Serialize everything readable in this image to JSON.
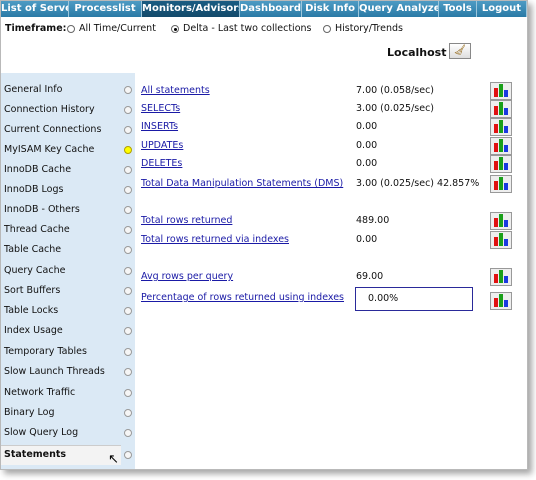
{
  "nav": {
    "tabs": [
      {
        "label": "List of Servers",
        "active": false
      },
      {
        "label": "Processlist",
        "active": false
      },
      {
        "label": "Monitors/Advisors",
        "active": true
      },
      {
        "label": "Dashboard",
        "active": false
      },
      {
        "label": "Disk Info",
        "active": false
      },
      {
        "label": "Query Analyzer",
        "active": false
      },
      {
        "label": "Tools",
        "active": false
      },
      {
        "label": "Logout",
        "active": false
      }
    ]
  },
  "timeframe": {
    "label": "Timeframe:",
    "options": [
      {
        "label": "All Time/Current",
        "selected": false
      },
      {
        "label": "Delta - Last two collections",
        "selected": true
      },
      {
        "label": "History/Trends",
        "selected": false
      }
    ]
  },
  "host": {
    "name": "Localhost",
    "button_icon": "broom-icon"
  },
  "sidebar": {
    "items": [
      {
        "label": "General Info",
        "status": "none"
      },
      {
        "label": "Connection History",
        "status": "none"
      },
      {
        "label": "Current Connections",
        "status": "none"
      },
      {
        "label": "MyISAM Key Cache",
        "status": "warning"
      },
      {
        "label": "InnoDB Cache",
        "status": "none"
      },
      {
        "label": "InnoDB Logs",
        "status": "none"
      },
      {
        "label": "InnoDB - Others",
        "status": "none"
      },
      {
        "label": "Thread Cache",
        "status": "none"
      },
      {
        "label": "Table Cache",
        "status": "none"
      },
      {
        "label": "Query Cache",
        "status": "none"
      },
      {
        "label": "Sort Buffers",
        "status": "none"
      },
      {
        "label": "Table Locks",
        "status": "none"
      },
      {
        "label": "Index Usage",
        "status": "none"
      },
      {
        "label": "Temporary Tables",
        "status": "none"
      },
      {
        "label": "Slow Launch Threads",
        "status": "none"
      },
      {
        "label": "Network Traffic",
        "status": "none"
      },
      {
        "label": "Binary Log",
        "status": "none"
      },
      {
        "label": "Slow Query Log",
        "status": "none"
      },
      {
        "label": "Statements",
        "status": "none",
        "selected": true
      }
    ]
  },
  "stats": [
    {
      "label": "All statements",
      "value": "7.00 (0.058/sec)"
    },
    {
      "label": "SELECTs",
      "value": "3.00 (0.025/sec)"
    },
    {
      "label": "INSERTs",
      "value": "0.00"
    },
    {
      "label": "UPDATEs",
      "value": "0.00"
    },
    {
      "label": "DELETEs",
      "value": "0.00"
    },
    {
      "label": "Total Data Manipulation Statements (DMS)",
      "value": "3.00 (0.025/sec) 42.857%"
    },
    {
      "label": "Total rows returned",
      "value": "489.00"
    },
    {
      "label": "Total rows returned via indexes",
      "value": "0.00"
    },
    {
      "label": "Avg rows per query",
      "value": "69.00"
    },
    {
      "label": "Percentage of rows returned using indexes",
      "value": "0.00%",
      "boxed": true
    }
  ],
  "colors": {
    "nav_bg": "#2e7faa",
    "nav_active": "#134a6b",
    "sidebar_bg": "#dbe9f5",
    "link": "#1a1aa6",
    "warning": "#ffff00"
  }
}
